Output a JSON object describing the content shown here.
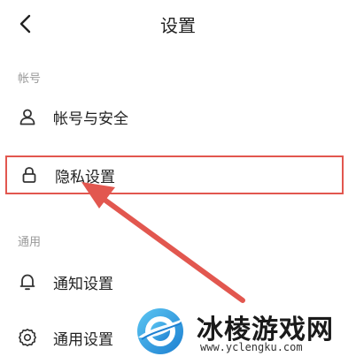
{
  "header": {
    "title": "设置",
    "back_icon": "chevron-left-icon"
  },
  "sections": [
    {
      "label": "帐号",
      "items": [
        {
          "label": "帐号与安全",
          "icon": "user-icon"
        },
        {
          "label": "隐私设置",
          "icon": "lock-icon",
          "highlighted": true
        }
      ]
    },
    {
      "label": "通用",
      "items": [
        {
          "label": "通知设置",
          "icon": "bell-icon"
        },
        {
          "label": "通用设置",
          "icon": "gear-icon"
        }
      ]
    }
  ],
  "annotation": {
    "color": "#e2574f"
  },
  "watermark": {
    "name": "冰棱游戏网",
    "url": "www.yclengku.com"
  }
}
